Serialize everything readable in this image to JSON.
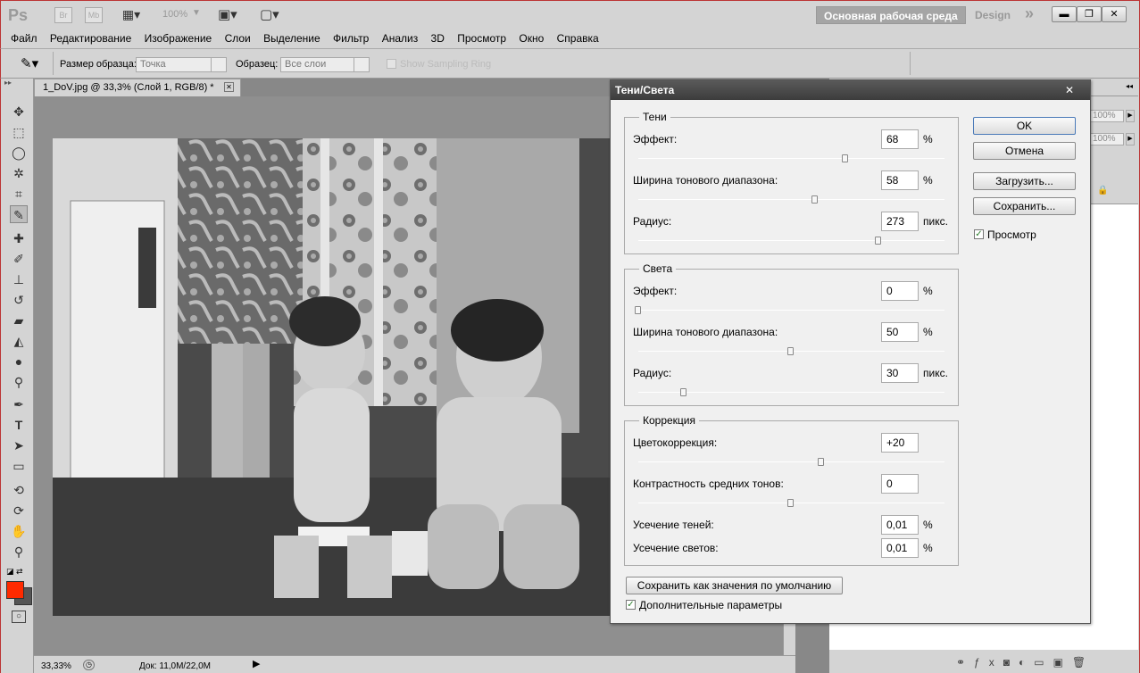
{
  "app": {
    "logo": "Ps",
    "br": "Br",
    "mb": "Mb",
    "zoom": "100%"
  },
  "workspace": {
    "main": "Основная рабочая среда",
    "design": "Design",
    "more": "»"
  },
  "menu": [
    "Файл",
    "Редактирование",
    "Изображение",
    "Слои",
    "Выделение",
    "Фильтр",
    "Анализ",
    "3D",
    "Просмотр",
    "Окно",
    "Справка"
  ],
  "options": {
    "sample_size_label": "Размер образца:",
    "sample_size_value": "Точка",
    "sample_label": "Образец:",
    "sample_value": "Все слои",
    "show_ring": "Show Sampling Ring"
  },
  "document": {
    "tab": "1_DoV.jpg @ 33,3% (Слой 1, RGB/8) *",
    "close": "✕"
  },
  "status": {
    "zoom": "33,33%",
    "doc": "Док: 11,0M/22,0M"
  },
  "right_panel": {
    "pct1": "100%",
    "pct2": "100%"
  },
  "colors": {
    "foreground": "#ff2a00",
    "background": "#555555",
    "accent_border": "#b33333"
  },
  "dialog": {
    "title": "Тени/Света",
    "close": "✕",
    "shadows": {
      "legend": "Тени",
      "amount_label": "Эффект:",
      "amount": "68",
      "amount_unit": "%",
      "amount_level": 0.68,
      "tonal_label": "Ширина тонового диапазона:",
      "tonal": "58",
      "tonal_unit": "%",
      "tonal_level": 0.58,
      "radius_label": "Радиус:",
      "radius": "273",
      "radius_unit": "пикс.",
      "radius_level": 0.78
    },
    "highlights": {
      "legend": "Света",
      "amount_label": "Эффект:",
      "amount": "0",
      "amount_unit": "%",
      "amount_level": 0,
      "tonal_label": "Ширина тонового диапазона:",
      "tonal": "50",
      "tonal_unit": "%",
      "tonal_level": 0.5,
      "radius_label": "Радиус:",
      "radius": "30",
      "radius_unit": "пикс.",
      "radius_level": 0.15
    },
    "adjust": {
      "legend": "Коррекция",
      "color_label": "Цветокоррекция:",
      "color": "+20",
      "color_level": 0.6,
      "midtone_label": "Контрастность средних тонов:",
      "midtone": "0",
      "midtone_level": 0.5,
      "black_clip_label": "Усечение теней:",
      "black_clip": "0,01",
      "black_clip_unit": "%",
      "white_clip_label": "Усечение светов:",
      "white_clip": "0,01",
      "white_clip_unit": "%"
    },
    "buttons": {
      "ok": "OK",
      "cancel": "Отмена",
      "load": "Загрузить...",
      "save": "Сохранить...",
      "save_defaults": "Сохранить как значения по умолчанию"
    },
    "preview_label": "Просмотр",
    "more_options_label": "Дополнительные параметры"
  }
}
